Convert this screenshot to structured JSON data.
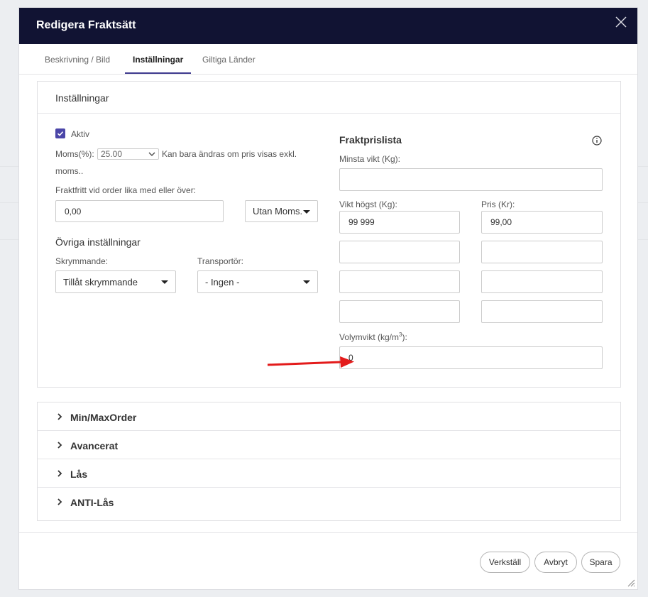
{
  "modal": {
    "title": "Redigera Fraktsätt",
    "close_icon": "close-icon"
  },
  "tabs": [
    {
      "label": "Beskrivning / Bild",
      "active": false
    },
    {
      "label": "Inställningar",
      "active": true
    },
    {
      "label": "Giltiga Länder",
      "active": false
    }
  ],
  "settings": {
    "title": "Inställningar",
    "active_label": "Aktiv",
    "active_checked": true,
    "vat_label": "Moms(%):",
    "vat_value": "25.00",
    "vat_note_1": "Kan bara ändras om pris visas exkl.",
    "vat_note_2": "moms..",
    "free_shipping_label": "Fraktfritt vid order lika med eller över:",
    "free_shipping_value": "0,00",
    "vat_mode": "Utan Moms.",
    "other_heading": "Övriga inställningar",
    "bulky_label": "Skrymmande:",
    "bulky_value": "Tillåt skrymmande",
    "carrier_label": "Transportör:",
    "carrier_value": "- Ingen -"
  },
  "pricelist": {
    "heading": "Fraktprislista",
    "min_weight_label": "Minsta vikt (Kg):",
    "min_weight_value": "",
    "max_weight_label": "Vikt högst (Kg):",
    "price_label": "Pris (Kr):",
    "rows": [
      {
        "weight": "99 999",
        "price": "99,00"
      },
      {
        "weight": "",
        "price": ""
      },
      {
        "weight": "",
        "price": ""
      },
      {
        "weight": "",
        "price": ""
      }
    ],
    "volume_label": "Volymvikt (kg/m",
    "volume_sup": "3",
    "volume_label_end": "):",
    "volume_value": "0"
  },
  "accordion": [
    {
      "label": "Min/MaxOrder"
    },
    {
      "label": "Avancerat"
    },
    {
      "label": "Lås"
    },
    {
      "label": "ANTI-Lås"
    }
  ],
  "footer": {
    "apply": "Verkställ",
    "cancel": "Avbryt",
    "save": "Spara"
  },
  "colors": {
    "header_bg": "#111333",
    "accent": "#4b46a8",
    "annotation_arrow": "#e31b1b"
  }
}
